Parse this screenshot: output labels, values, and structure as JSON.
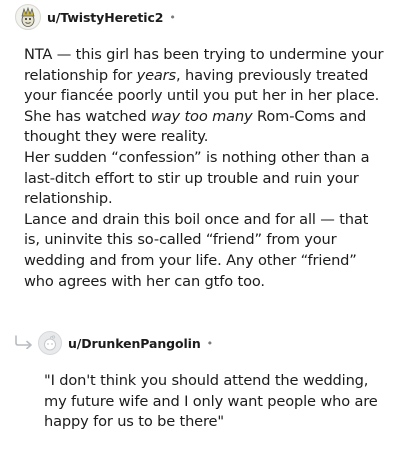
{
  "comment": {
    "username": "u/TwistyHeretic2",
    "separator": "•",
    "avatar_icon": "character-avatar-icon",
    "paragraphs": [
      [
        {
          "t": "NTA — this girl has been trying to undermine your relationship for "
        },
        {
          "t": "years",
          "i": true
        },
        {
          "t": ", having previously treated your fiancée poorly until you put her in her place. She has watched "
        },
        {
          "t": "way too many",
          "i": true
        },
        {
          "t": " Rom-Coms and thought they were reality."
        }
      ],
      [
        {
          "t": "Her sudden “confession” is nothing other than a last-ditch effort to stir up trouble and ruin your relationship."
        }
      ],
      [
        {
          "t": "Lance and drain this boil once and for all — that is, uninvite this so-called “friend” from your wedding and from your life. Any other “friend” who agrees with her can gtfo too."
        }
      ]
    ]
  },
  "reply": {
    "username": "u/DrunkenPangolin",
    "separator": "•",
    "avatar_icon": "default-snoo-avatar-icon",
    "reply_icon": "reply-arrow-icon",
    "text": "\"I don't think you should attend the wedding, my future wife and I only want people who are happy for us to be there\""
  }
}
